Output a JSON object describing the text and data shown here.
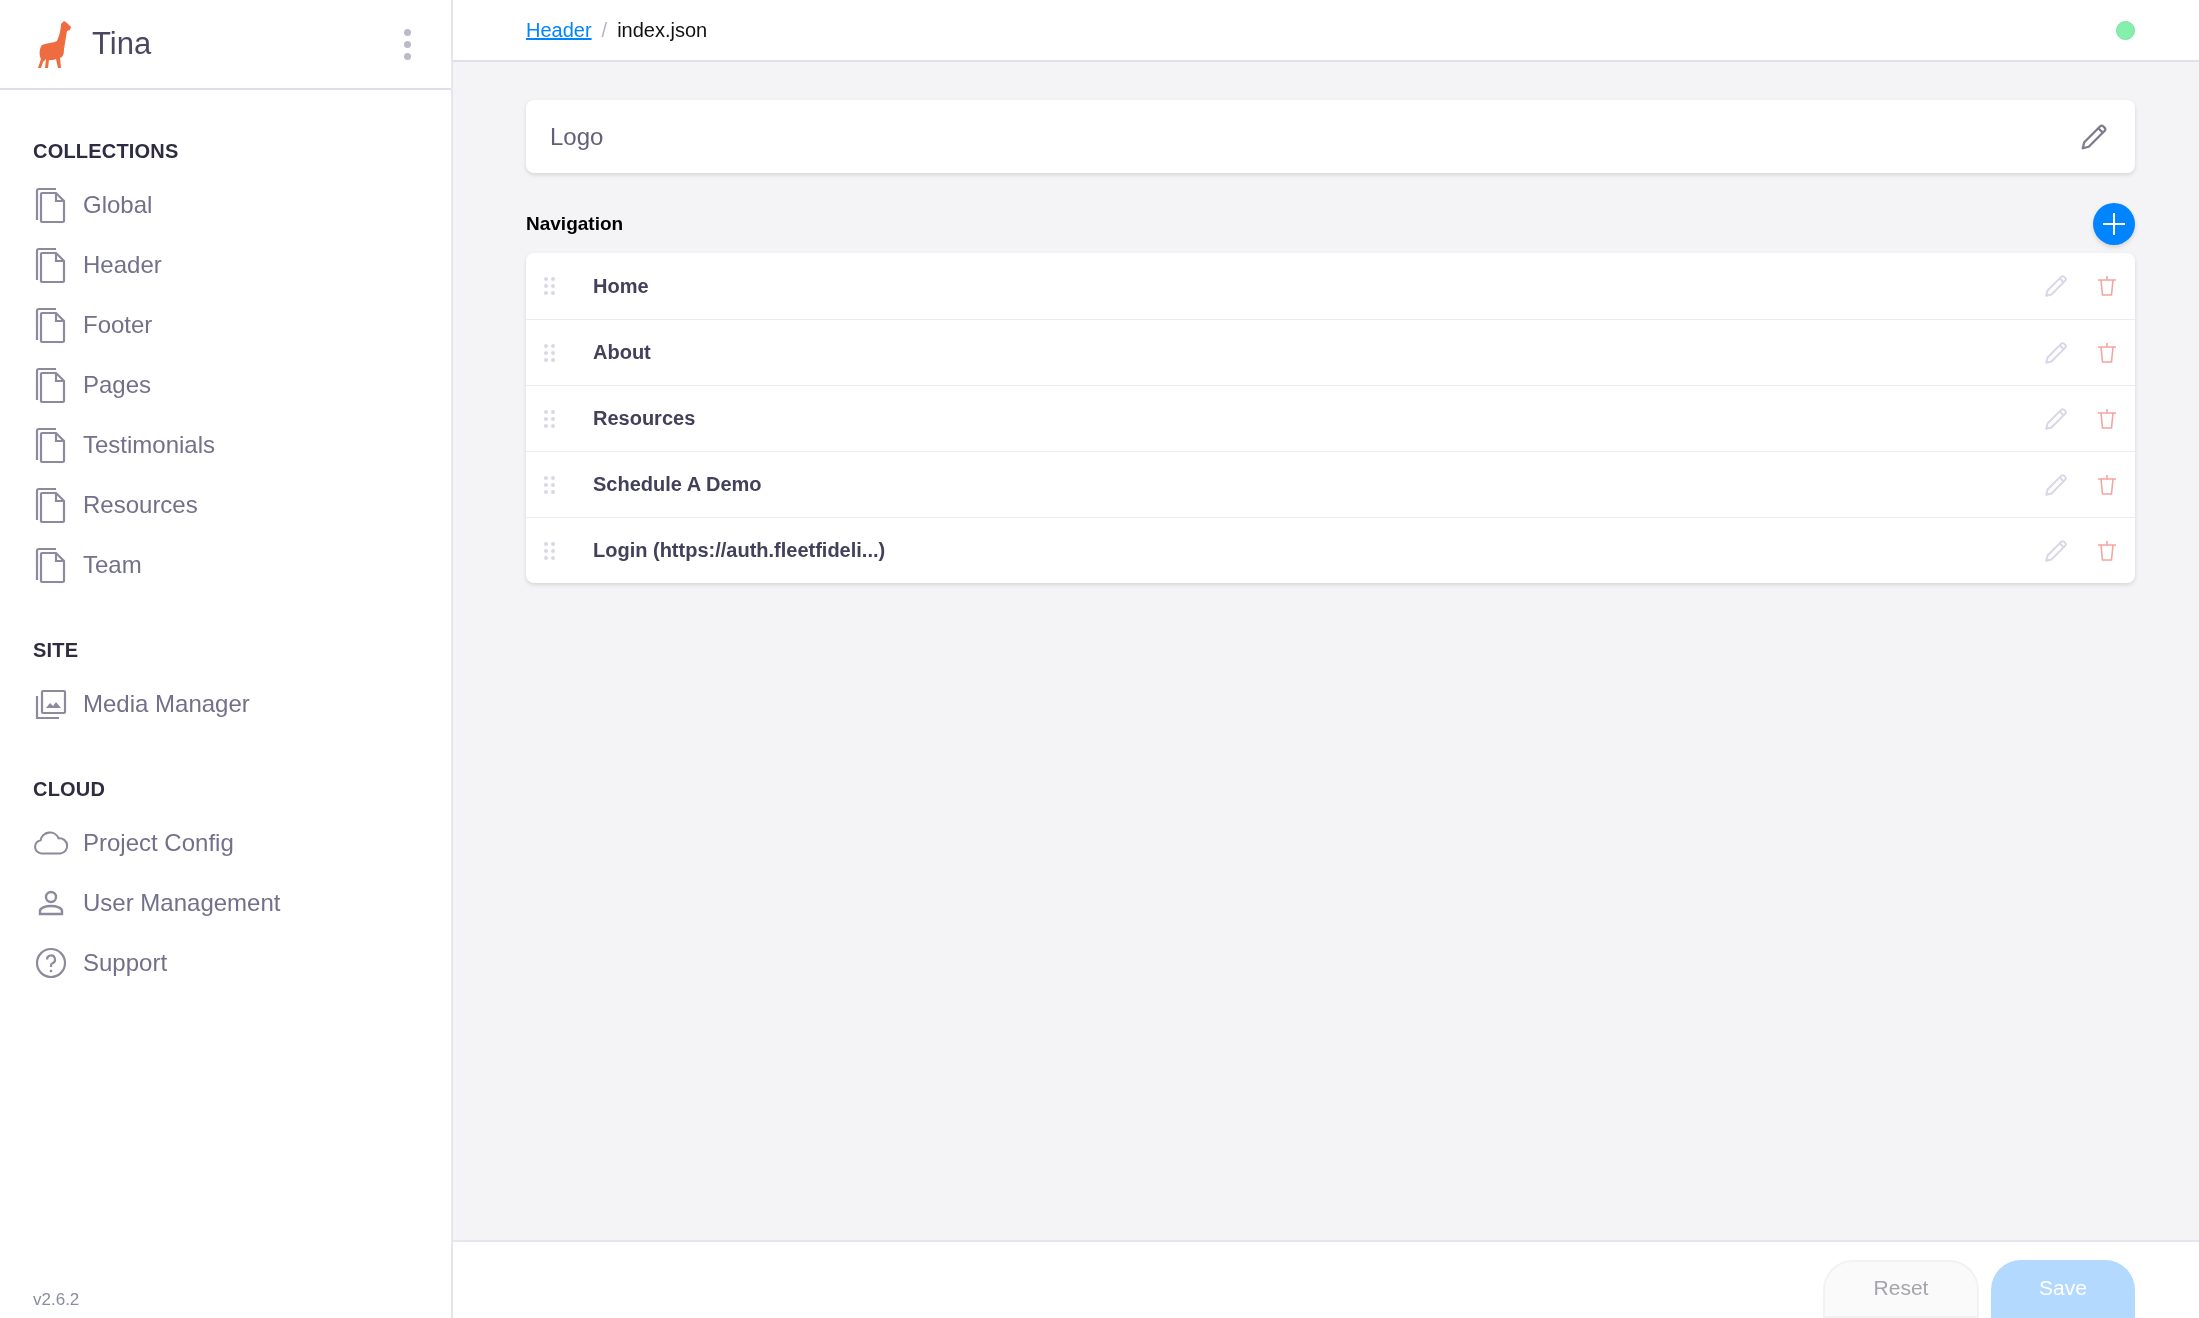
{
  "sidebar": {
    "brand": "Tina",
    "sections": [
      {
        "title": "COLLECTIONS",
        "items": [
          {
            "label": "Global",
            "kind": "document"
          },
          {
            "label": "Header",
            "kind": "document"
          },
          {
            "label": "Footer",
            "kind": "document"
          },
          {
            "label": "Pages",
            "kind": "document"
          },
          {
            "label": "Testimonials",
            "kind": "document"
          },
          {
            "label": "Resources",
            "kind": "document"
          },
          {
            "label": "Team",
            "kind": "document"
          }
        ]
      },
      {
        "title": "SITE",
        "items": [
          {
            "label": "Media Manager",
            "kind": "media"
          }
        ]
      },
      {
        "title": "CLOUD",
        "items": [
          {
            "label": "Project Config",
            "kind": "cloud"
          },
          {
            "label": "User Management",
            "kind": "user"
          },
          {
            "label": "Support",
            "kind": "help"
          }
        ]
      }
    ],
    "version": "v2.6.2"
  },
  "breadcrumb": {
    "link": "Header",
    "separator": "/",
    "current": "index.json"
  },
  "logo_field": {
    "label": "Logo"
  },
  "navigation": {
    "title": "Navigation",
    "items": [
      {
        "label": "Home"
      },
      {
        "label": "About"
      },
      {
        "label": "Resources"
      },
      {
        "label": "Schedule A Demo"
      },
      {
        "label": "Login (https://auth.fleetfideli...)"
      }
    ]
  },
  "footer": {
    "buttons": [
      {
        "label": "Reset",
        "kind": "secondary",
        "disabled": true
      },
      {
        "label": "Save",
        "kind": "primary",
        "disabled": true
      }
    ]
  }
}
